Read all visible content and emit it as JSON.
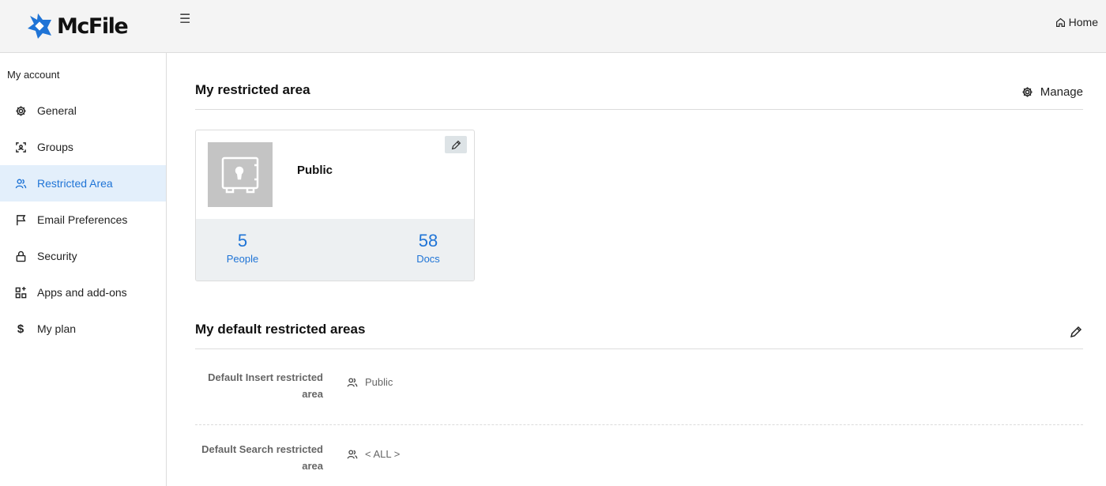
{
  "header": {
    "logo_text": "McFile",
    "home_label": "Home",
    "brand_color": "#1f74d6"
  },
  "sidebar": {
    "heading": "My account",
    "items": [
      {
        "label": "General",
        "icon": "gear-icon"
      },
      {
        "label": "Groups",
        "icon": "groups-icon"
      },
      {
        "label": "Restricted Area",
        "icon": "people-icon",
        "active": true
      },
      {
        "label": "Email Preferences",
        "icon": "flag-icon"
      },
      {
        "label": "Security",
        "icon": "lock-icon"
      },
      {
        "label": "Apps and add-ons",
        "icon": "apps-icon"
      },
      {
        "label": "My plan",
        "icon": "dollar-icon"
      }
    ]
  },
  "restricted_area": {
    "title": "My restricted area",
    "manage_label": "Manage",
    "card": {
      "name": "Public",
      "thumbnail_icon": "safe-icon",
      "people_count": "5",
      "people_label": "People",
      "docs_count": "58",
      "docs_label": "Docs"
    }
  },
  "default_areas": {
    "title": "My default restricted areas",
    "rows": [
      {
        "label": "Default Insert restricted area",
        "value": "Public"
      },
      {
        "label": "Default Search restricted area",
        "value": "< ALL >"
      }
    ]
  }
}
